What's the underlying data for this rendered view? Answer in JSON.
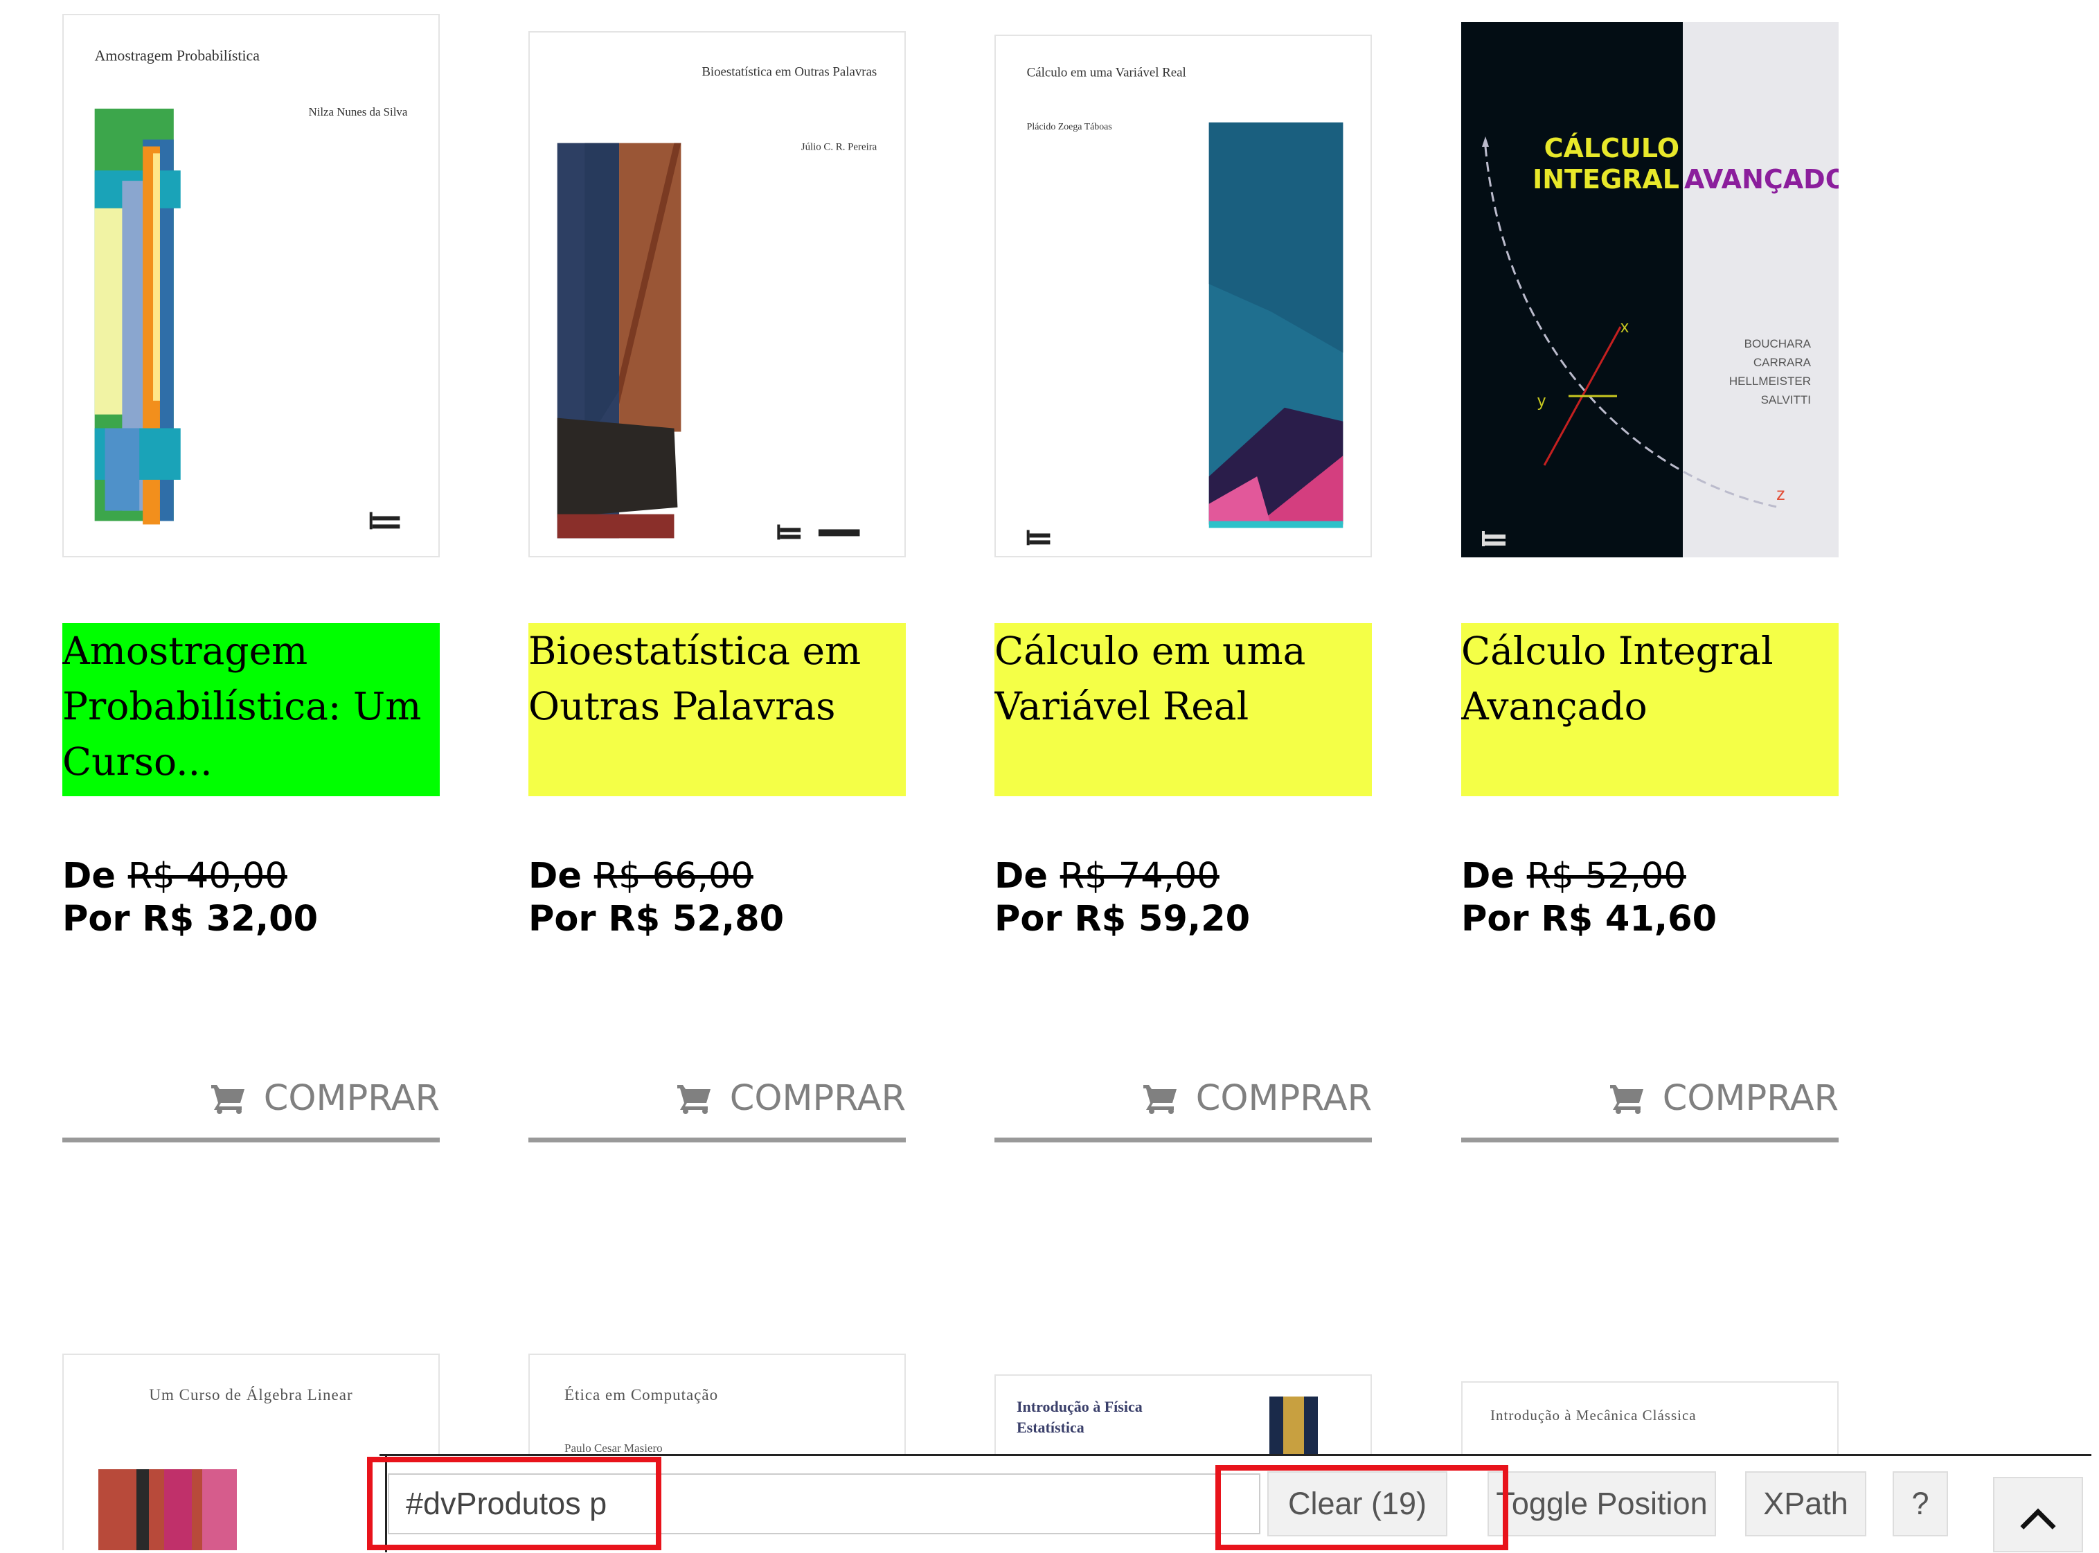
{
  "products": [
    {
      "cover_title": "Amostragem Probabilística",
      "cover_author": "Nilza Nunes da Silva",
      "title": "Amostragem Probabilística: Um Curso...",
      "title_highlight": "#00ff00",
      "price_from_label": "De",
      "price_from": "R$ 40,00",
      "price_to": "Por R$ 32,00",
      "buy_label": "COMPRAR"
    },
    {
      "cover_title": "Bioestatística em Outras Palavras",
      "cover_author": "Júlio C. R. Pereira",
      "title": "Bioestatística em Outras Palavras",
      "title_highlight": "#f4ff47",
      "price_from_label": "De",
      "price_from": "R$ 66,00",
      "price_to": "Por R$ 52,80",
      "buy_label": "COMPRAR"
    },
    {
      "cover_title": "Cálculo em uma Variável Real",
      "cover_author": "Plácido Zoega Táboas",
      "title": "Cálculo em uma Variável Real",
      "title_highlight": "#f4ff47",
      "price_from_label": "De",
      "price_from": "R$ 74,00",
      "price_to": "Por R$ 59,20",
      "buy_label": "COMPRAR"
    },
    {
      "cover_title_1": "CÁLCULO",
      "cover_title_2": "INTEGRAL",
      "cover_title_3": "AVANÇADO",
      "cover_authors": [
        "BOUCHARA",
        "CARRARA",
        "HELLMEISTER",
        "SALVITTI"
      ],
      "axis_x": "x",
      "axis_y": "y",
      "axis_z": "z",
      "title": "Cálculo Integral Avançado",
      "title_highlight": "#f4ff47",
      "price_from_label": "De",
      "price_from": "R$ 52,00",
      "price_to": "Por R$ 41,60",
      "buy_label": "COMPRAR"
    }
  ],
  "row2_covers": [
    {
      "cover_title": "Um Curso de Álgebra Linear"
    },
    {
      "cover_title": "Ética em Computação",
      "cover_author": "Paulo Cesar Masiero"
    },
    {
      "cover_title": "Introdução à Física Estatística"
    },
    {
      "cover_title": "Introdução à Mecânica Clássica"
    }
  ],
  "toolbar": {
    "selector_value": "#dvProdutos p",
    "clear_label": "Clear (19)",
    "toggle_label": "Toggle Position",
    "xpath_label": "XPath",
    "help_label": "?"
  },
  "colors": {
    "highlight_green": "#00ff00",
    "highlight_yellow": "#f4ff47",
    "red_outline": "#e8131b",
    "button_gray": "#808080"
  },
  "icons": [
    "cart-icon",
    "chevron-up-icon"
  ]
}
